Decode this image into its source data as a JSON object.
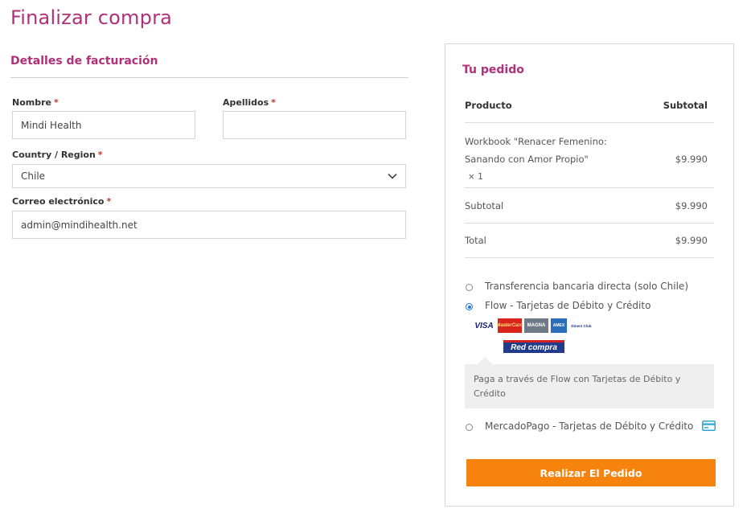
{
  "page": {
    "title": "Finalizar compra"
  },
  "billing": {
    "heading": "Detalles de facturación",
    "first_name": {
      "label": "Nombre",
      "required": "*",
      "value": "Mindi Health"
    },
    "last_name": {
      "label": "Apellidos",
      "required": "*",
      "value": ""
    },
    "country": {
      "label": "Country / Region",
      "required": "*",
      "value": "Chile"
    },
    "email": {
      "label": "Correo electrónico",
      "required": "*",
      "value": "admin@mindihealth.net"
    }
  },
  "order": {
    "heading": "Tu pedido",
    "col_product": "Producto",
    "col_subtotal": "Subtotal",
    "item": {
      "line1": "Workbook \"Renacer Femenino:",
      "line2": "Sanando con Amor Propio\"",
      "qty": "× 1",
      "price": "$9.990"
    },
    "subtotal": {
      "label": "Subtotal",
      "value": "$9.990"
    },
    "total": {
      "label": "Total",
      "value": "$9.990"
    }
  },
  "payment": {
    "options": [
      {
        "label": "Transferencia bancaria directa (solo Chile)",
        "selected": false
      },
      {
        "label": "Flow - Tarjetas de Débito y Crédito",
        "selected": true
      },
      {
        "label": "MercadoPago - Tarjetas de Débito y Crédito",
        "selected": false
      }
    ],
    "cards": [
      "VISA",
      "MasterCard",
      "MAGNA",
      "AMEX",
      "Diners Club"
    ],
    "redcompra": "Red compra",
    "description": "Paga a través de Flow con Tarjetas de Débito y Crédito",
    "place_order": "Realizar El Pedido"
  },
  "colors": {
    "brand": "#b0307a",
    "button": "#f7830f",
    "radio_selected": "#1e73e8"
  },
  "icons": [
    "chevron-down-icon",
    "credit-card-icon"
  ]
}
